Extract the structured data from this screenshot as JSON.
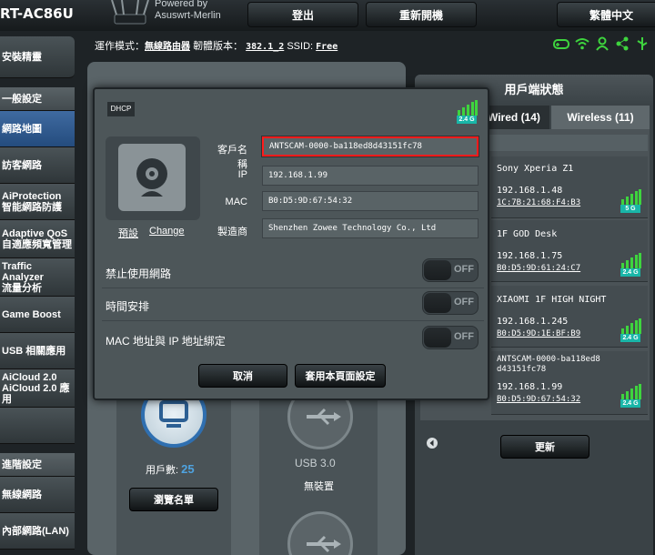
{
  "topbar": {
    "brand": "RT-AC86U",
    "powered_by": "Powered by",
    "firmware_name": "Asuswrt-Merlin",
    "logout": "登出",
    "reboot": "重新開機",
    "language": "繁體中文"
  },
  "status": {
    "mode_label": "運作模式：",
    "mode_value": "無線路由器",
    "fw_label": "韌體版本：",
    "fw_value": "382.1_2",
    "ssid_label": "SSID:",
    "ssid_value": "Free"
  },
  "menu": [
    {
      "l1": "安裝精靈",
      "l2": ""
    },
    {
      "l1": "一般設定",
      "l2": ""
    },
    {
      "l1": "網路地圖",
      "l2": ""
    },
    {
      "l1": "訪客網路",
      "l2": ""
    },
    {
      "l1": "AiProtection",
      "l2": "智能網路防護"
    },
    {
      "l1": "Adaptive QoS",
      "l2": "自適應頻寬管理"
    },
    {
      "l1": "Traffic Analyzer",
      "l2": "流量分析"
    },
    {
      "l1": "Game Boost",
      "l2": ""
    },
    {
      "l1": "USB 相關應用",
      "l2": ""
    },
    {
      "l1": "AiCloud 2.0",
      "l2": "AiCloud 2.0 應用"
    },
    {
      "l1": "",
      "l2": ""
    },
    {
      "l1": "進階設定",
      "l2": ""
    },
    {
      "l1": "無線網路",
      "l2": ""
    },
    {
      "l1": "內部網路(LAN)",
      "l2": ""
    }
  ],
  "modal": {
    "badge": "DHCP",
    "band": "2.4 G",
    "preset_link": "預設",
    "change_link": "Change",
    "name_label": "客戶名稱",
    "name_value": "ANTSCAM-0000-ba118ed8d43151fc78",
    "ip_label": "IP",
    "ip_value": "192.168.1.99",
    "mac_label": "MAC",
    "mac_value": "B0:D5:9D:67:54:32",
    "vendor_label": "製造商",
    "vendor_value": "Shenzhen Zowee Technology Co., Ltd",
    "block_label": "禁止使用網路",
    "schedule_label": "時間安排",
    "bind_label": "MAC 地址與 IP 地址綁定",
    "off": "OFF",
    "cancel": "取消",
    "apply": "套用本頁面設定"
  },
  "map": {
    "clients_label": "用戶數:",
    "clients_count": "25",
    "view_list": "瀏覽名單",
    "usb_label": "USB 3.0",
    "usb_status": "無裝置"
  },
  "client_panel": {
    "title": "用戶端狀態",
    "tab_wired": "Wired (14)",
    "tab_wireless": "Wireless (11)",
    "refresh": "更新",
    "clients": [
      {
        "name": "Sony Xperia Z1",
        "ip": "192.168.1.48",
        "mac": "1C:7B:21:68:F4:B3",
        "band": "5 G"
      },
      {
        "name": "1F GOD Desk",
        "ip": "192.168.1.75",
        "mac": "B0:D5:9D:61:24:C7",
        "band": "2.4 G"
      },
      {
        "name": "XIAOMI 1F HIGH NIGHT",
        "ip": "192.168.1.245",
        "mac": "B0:D5:9D:1E:BF:B9",
        "band": "2.4 G"
      },
      {
        "name": "ANTSCAM-0000-ba118ed8",
        "name2": "d43151fc78",
        "ip": "192.168.1.99",
        "mac": "B0:D5:9D:67:54:32",
        "band": "2.4 G"
      }
    ]
  },
  "colors": {
    "accent_teal": "#19b6a8",
    "signal_green": "#3ed43e",
    "highlight_red": "#ff1b1b"
  }
}
